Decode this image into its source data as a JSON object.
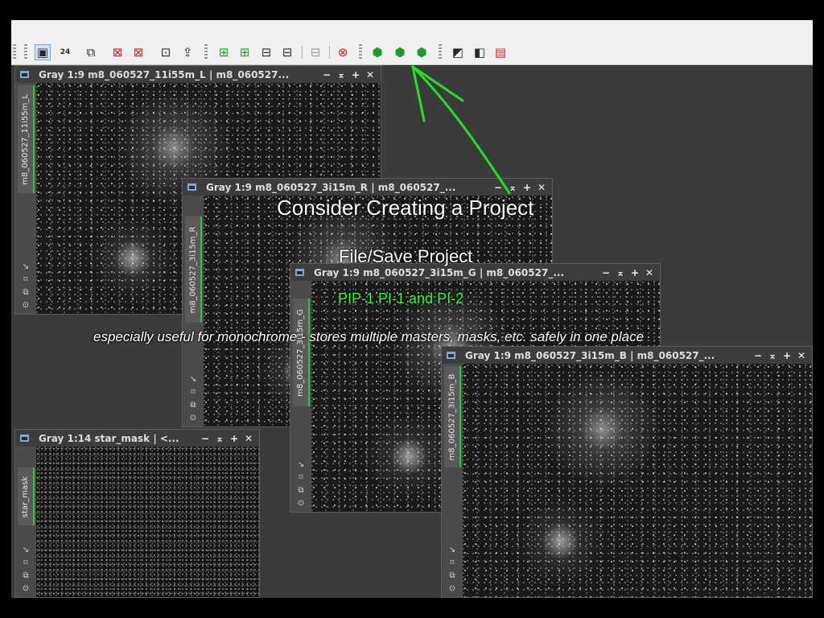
{
  "toolbar": {
    "buttons": [
      {
        "icon": "monitor-icon",
        "glyph": "▣"
      },
      {
        "icon": "screen-24bit-icon",
        "glyph": "24"
      },
      {
        "icon": "window-import-icon",
        "glyph": "⧉"
      },
      {
        "icon": "window-close-icon",
        "glyph": "⊠"
      },
      {
        "icon": "window-delete-icon",
        "glyph": "⊠"
      },
      {
        "icon": "window-ok-icon",
        "glyph": "⊡"
      },
      {
        "icon": "window-upload-icon",
        "glyph": "⇪"
      },
      {
        "icon": "grid-add-icon",
        "glyph": "⊞"
      },
      {
        "icon": "grid-play-icon",
        "glyph": "⊞"
      },
      {
        "icon": "grid-save-icon",
        "glyph": "⊟"
      },
      {
        "icon": "grid-list-icon",
        "glyph": "⊟"
      },
      {
        "icon": "grid-disabled-icon",
        "glyph": "⊟"
      },
      {
        "icon": "grid-close-icon",
        "glyph": "⊗"
      },
      {
        "icon": "project-new-icon",
        "glyph": "⬢"
      },
      {
        "icon": "project-save-icon",
        "glyph": "⬢"
      },
      {
        "icon": "project-open-icon",
        "glyph": "⬢"
      },
      {
        "icon": "stf-auto-icon",
        "glyph": "◩"
      },
      {
        "icon": "stf-reset-icon",
        "glyph": "◧"
      },
      {
        "icon": "preview-export-icon",
        "glyph": "▤"
      }
    ]
  },
  "windows": {
    "L": {
      "title": "Gray 1:9 m8_060527_11i55m_L | m8_060527...",
      "tab": "m8_060527_11i55m_L"
    },
    "R": {
      "title": "Gray 1:9 m8_060527_3i15m_R | m8_060527_...",
      "tab": "m8_060527_3i15m_R"
    },
    "G": {
      "title": "Gray 1:9 m8_060527_3i15m_G | m8_060527_...",
      "tab": "m8_060527_3i15m_G"
    },
    "B": {
      "title": "Gray 1:9 m8_060527_3i15m_B | m8_060527_...",
      "tab": "m8_060527_3i15m_B"
    },
    "mask": {
      "title": "Gray 1:14 star_mask | <...",
      "tab": "star_mask"
    }
  },
  "window_controls": {
    "minimize": "−",
    "shade": "⌅",
    "maximize": "+",
    "close": "✕"
  },
  "sidebar_icons": [
    "↘",
    "⌑",
    "⧉",
    "⊙"
  ],
  "overlay": {
    "title": "Consider Creating a Project",
    "save": "File/Save Project",
    "refs": "PIP-1 PI-1 and PI-2",
    "note": "especially useful for monochrome - stores multiple masters, masks, etc. safely in one place"
  },
  "colors": {
    "accent_green": "#33ff33",
    "tab_green": "#27c93f",
    "workspace": "#3b3b3b"
  }
}
